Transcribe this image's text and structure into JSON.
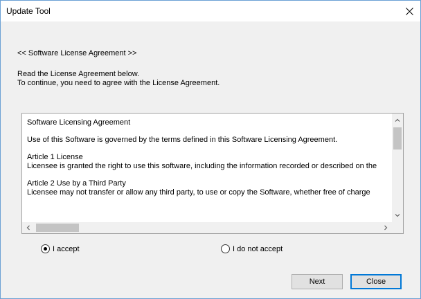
{
  "window": {
    "title": "Update Tool"
  },
  "heading": "<< Software License Agreement >>",
  "instructions": [
    "Read the License Agreement below.",
    "To continue, you need to agree with the License Agreement."
  ],
  "license": {
    "title": "Software Licensing Agreement",
    "intro": "Use of this Software is governed by the terms defined in this Software Licensing Agreement.",
    "articles": [
      {
        "heading": "Article 1 License",
        "body": "Licensee is granted the right to use this software, including the information recorded or described on the"
      },
      {
        "heading": "Article 2 Use by a Third Party",
        "body": "Licensee may not transfer or allow any third party, to use or copy the Software, whether free of charge"
      }
    ]
  },
  "options": {
    "accept": {
      "label": "I accept",
      "selected": true
    },
    "decline": {
      "label": "I do not accept",
      "selected": false
    }
  },
  "buttons": {
    "next": "Next",
    "close": "Close"
  }
}
